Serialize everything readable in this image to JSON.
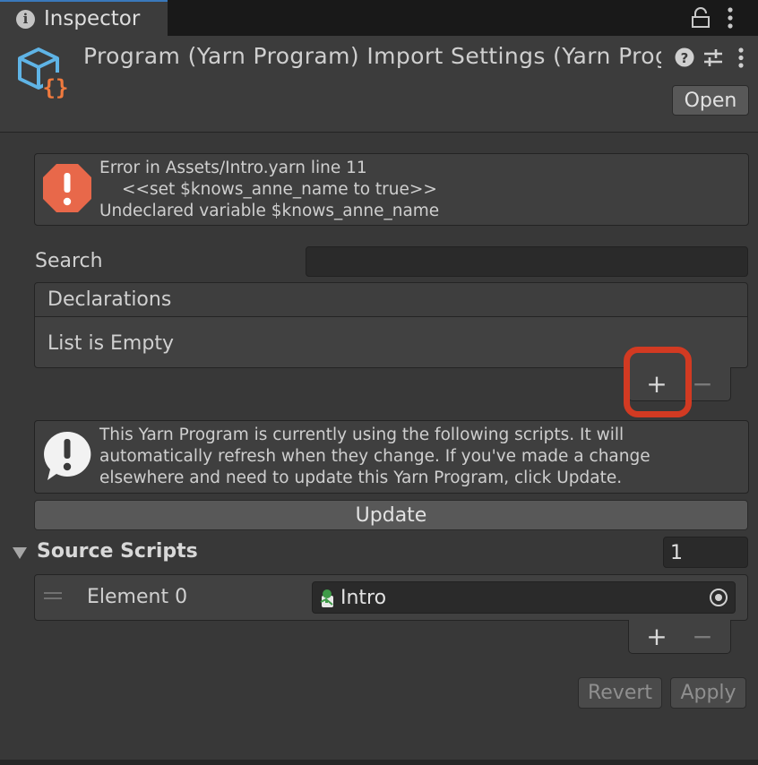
{
  "tab": {
    "title": "Inspector",
    "info_icon": "info-icon"
  },
  "header": {
    "title": "Program (Yarn Program) Import Settings (Yarn Prog",
    "open_label": "Open",
    "icons": [
      "yarn-program-asset-icon",
      "help-icon",
      "settings-sliders-icon",
      "more-vertical-icon",
      "lock-icon"
    ]
  },
  "error_box": {
    "line1": "Error in Assets/Intro.yarn line 11",
    "line2": "<<set $knows_anne_name to true>>",
    "line3": "Undeclared variable $knows_anne_name"
  },
  "search": {
    "label": "Search",
    "value": ""
  },
  "declarations": {
    "header": "Declarations",
    "empty_text": "List is Empty",
    "add_label": "+",
    "remove_label": "−"
  },
  "info_box": {
    "line1": "This Yarn Program is currently using the following scripts. It will",
    "line2": "automatically refresh when they change. If you've made a change",
    "line3": "elsewhere and need to update this Yarn Program, click Update."
  },
  "update_label": "Update",
  "source_scripts": {
    "label": "Source Scripts",
    "count": "1",
    "elements": [
      {
        "label": "Element 0",
        "value": "Intro"
      }
    ],
    "add_label": "+",
    "remove_label": "−"
  },
  "revert_label": "Revert",
  "apply_label": "Apply",
  "colors": {
    "highlight": "#d23a22",
    "accent_tab": "#3a79bb",
    "error_icon": "#e8684a",
    "asset_icon_blue": "#5fb4e6",
    "asset_icon_orange": "#f07a3e"
  }
}
